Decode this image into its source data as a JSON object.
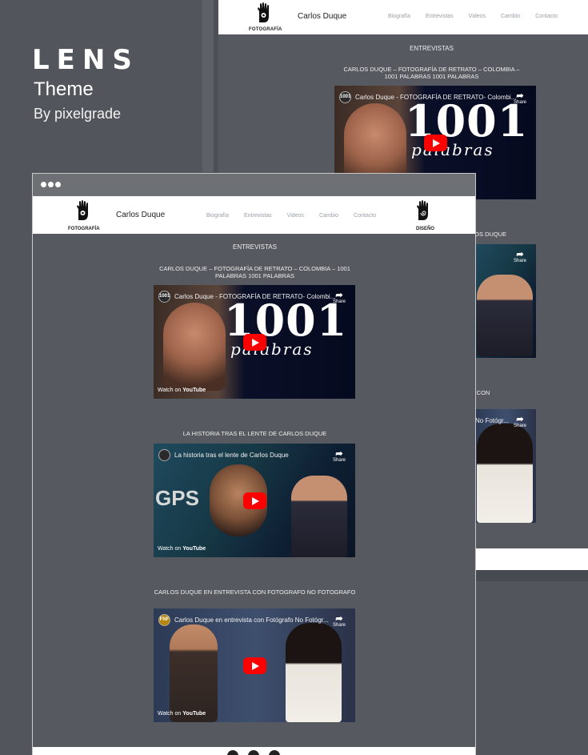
{
  "promo": {
    "title": "LENS",
    "subtitle": "Theme",
    "byline": "By pixelgrade"
  },
  "site": {
    "title": "Carlos Duque",
    "logo_left_label": "FOTOGRAFÍA",
    "logo_right_label": "DISEÑO",
    "nav": [
      "Biografía",
      "Entrevistas",
      "Videos",
      "Cambio",
      "Contacto"
    ],
    "section_heading": "ENTREVISTAS"
  },
  "videos": [
    {
      "section_title": "CARLOS DUQUE – FOTOGRAFÍA DE RETRATO – COLOMBIA – 1001 PALABRAS 1001 PALABRAS",
      "player_title": "Carlos Duque - FOTOGRAFÍA DE RETRATO- Colombi...",
      "channel_badge": "1001",
      "art_big": "1001",
      "art_script": "palabras"
    },
    {
      "section_title": "LA HISTORIA TRAS EL LENTE DE CARLOS DUQUE",
      "player_title": "La historia tras el lente de Carlos Duque",
      "channel_badge": "",
      "art_big": "GPS"
    },
    {
      "section_title": "CARLOS DUQUE EN ENTREVISTA CON FOTOGRAFO NO FOTOGRAFO",
      "player_title": "Carlos Duque en entrevista con Fotógrafo No Fotógr...",
      "channel_badge": "FNF"
    }
  ],
  "player": {
    "share_label": "Share",
    "watch_on": "Watch on",
    "youtube": "YouTube"
  },
  "back_partial": {
    "title2_fragment": "LOS DUQUE",
    "title3_fragment_1": "A CON",
    "title3_fragment_2": "O",
    "player3_fragment": "No Fotógr..."
  },
  "colors": {
    "page_bg": "#52555b",
    "site_bg": "#56595f",
    "header_bg": "#ffffff",
    "nav_text": "#9aa0a6",
    "play_button": "#ff0000"
  }
}
